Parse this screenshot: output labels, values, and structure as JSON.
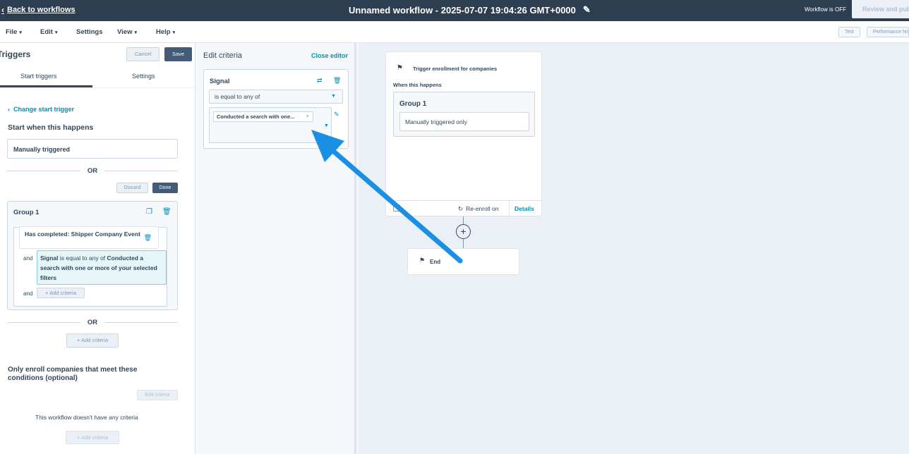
{
  "topbar": {
    "back_label": "Back to workflows",
    "workflow_title": "Unnamed workflow - 2025-07-07 19:04:26 GMT+0000",
    "status": "Workflow is OFF",
    "review_button": "Review and publish"
  },
  "menubar": {
    "items": [
      "File",
      "Edit",
      "Settings",
      "View",
      "Help"
    ],
    "test_button": "Test",
    "performance_button": "Performance history"
  },
  "left_panel": {
    "title": "Triggers",
    "cancel_button": "Cancel",
    "save_button": "Save",
    "tabs": [
      "Start triggers",
      "Settings"
    ],
    "change_trigger": "Change start trigger",
    "start_when": "Start when this happens",
    "manual_trigger": "Manually triggered",
    "or_label": "OR",
    "discard_button": "Discard",
    "done_button": "Done",
    "group": {
      "title": "Group 1",
      "has_completed": "Has completed: Shipper Company Event",
      "and_label": "and",
      "signal_name": "Signal",
      "signal_operator": "is equal to any of",
      "signal_value": "Conducted a search with one or more of your selected filters",
      "add_criteria": "Add criteria"
    },
    "add_criteria": "Add criteria",
    "only_enroll": "Only enroll companies that meet these conditions (optional)",
    "edit_criteria": "Edit criteria",
    "no_criteria": "This workflow doesn't have any criteria",
    "add_criteria_disabled": "Add criteria"
  },
  "edit_panel": {
    "title": "Edit criteria",
    "close_editor": "Close editor",
    "property": "Signal",
    "operator": "is equal to any of",
    "chip_value": "Conducted a search with one...",
    "chip_remove": "×"
  },
  "canvas": {
    "trigger_title": "Trigger enrollment for companies",
    "when_label": "When this happens",
    "group_title": "Group 1",
    "group_value": "Manually triggered only",
    "reenroll": "Re-enroll on",
    "details": "Details",
    "plus": "+",
    "end_label": "End"
  },
  "annotation": {
    "arrow_color": "#1a8fe3"
  }
}
